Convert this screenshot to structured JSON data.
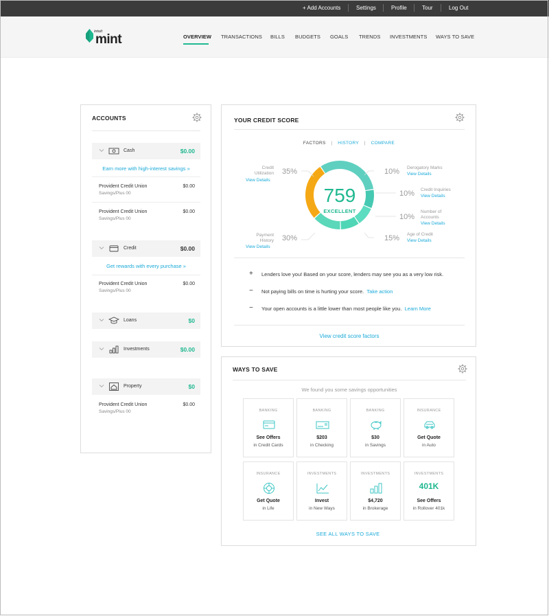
{
  "topbar": {
    "add_accounts": "+ Add Accounts",
    "settings": "Settings",
    "profile": "Profile",
    "tour": "Tour",
    "logout": "Log Out"
  },
  "brand": {
    "small": "intuit",
    "name": "mint",
    "color": "#1fb890"
  },
  "nav": [
    "OVERVIEW",
    "TRANSACTIONS",
    "BILLS",
    "BUDGETS",
    "GOALS",
    "TRENDS",
    "INVESTMENTS",
    "WAYS TO SAVE"
  ],
  "accounts": {
    "title": "ACCOUNTS",
    "cash": {
      "name": "Cash",
      "amount": "$0.00"
    },
    "cash_promo": "Earn more with high-interest savings »",
    "cash_accounts": [
      {
        "name": "Provident Credit Union",
        "sub": "Savings/Plus 00",
        "amount": "$0.00"
      },
      {
        "name": "Provident Credit Union",
        "sub": "Savings/Plus 00",
        "amount": "$0.00"
      }
    ],
    "credit": {
      "name": "Credit",
      "amount": "$0.00"
    },
    "credit_promo": "Get rewards with every purchase »",
    "credit_accounts": [
      {
        "name": "Provident Credit Union",
        "sub": "Savings/Plus 00",
        "amount": "$0.00"
      }
    ],
    "loans": {
      "name": "Loans",
      "amount": "$0"
    },
    "investments": {
      "name": "Investments",
      "amount": "$0.00"
    },
    "property": {
      "name": "Property",
      "amount": "$0"
    },
    "property_accounts": [
      {
        "name": "Provident Credit Union",
        "sub": "Savings/Plus 00",
        "amount": "$0.00"
      }
    ]
  },
  "credit_score": {
    "title": "YOUR CREDIT SCORE",
    "tabs": {
      "factors": "FACTORS",
      "sep": "|",
      "history": "HISTORY",
      "compare": "COMPARE"
    },
    "score": "759",
    "rating": "EXCELLENT",
    "left_factors": [
      {
        "label1": "Credit",
        "label2": "Utilization",
        "link": "View Details",
        "pct": "35%"
      },
      {
        "label1": "Payment",
        "label2": "History",
        "link": "View Details",
        "pct": "30%"
      }
    ],
    "right_factors": [
      {
        "pct": "10%",
        "label1": "Derogatory Marks",
        "label2": "",
        "link": "View Details"
      },
      {
        "pct": "10%",
        "label1": "Credit Inquiries",
        "label2": "",
        "link": "View Details"
      },
      {
        "pct": "10%",
        "label1": "Number of",
        "label2": "Accounts",
        "link": "View Details"
      },
      {
        "pct": "15%",
        "label1": "Age of Credit",
        "label2": "",
        "link": "View Details"
      }
    ],
    "notes": [
      {
        "sym": "+",
        "text": "Lenders love you!  Based on your score, lenders may see you as a very low risk.",
        "link": ""
      },
      {
        "sym": "−",
        "text": "Not paying bills on time is hurting your score.",
        "link": "Take action"
      },
      {
        "sym": "−",
        "text": "Your open accounts is a little lower than most people like you.",
        "link": "Learn More"
      }
    ],
    "footer_link": "View credit score factors",
    "segments": [
      {
        "name": "Credit Utilization",
        "share": 35,
        "color": "#5fd0c0"
      },
      {
        "name": "Derogatory Marks",
        "share": 10,
        "color": "#46c9b2"
      },
      {
        "name": "Credit Inquiries",
        "share": 10,
        "color": "#5cdcc0"
      },
      {
        "name": "Number of Accounts",
        "share": 10,
        "color": "#4fd6b6"
      },
      {
        "name": "Age of Credit",
        "share": 15,
        "color": "#5ad8b9"
      },
      {
        "name": "Payment History",
        "share": 30,
        "color": "#f5a815"
      }
    ]
  },
  "ways_to_save": {
    "title": "WAYS TO SAVE",
    "subtitle": "We found you some savings opportunities",
    "tiles": [
      {
        "category": "BANKING",
        "icon": "credit-card-icon",
        "value": "See Offers",
        "sub": "in Credit Cards"
      },
      {
        "category": "BANKING",
        "icon": "check-icon",
        "value": "$203",
        "sub": "in Checking"
      },
      {
        "category": "BANKING",
        "icon": "piggy-bank-icon",
        "value": "$30",
        "sub": "in Savings"
      },
      {
        "category": "INSURANCE",
        "icon": "car-icon",
        "value": "Get Quote",
        "sub": "in Auto"
      },
      {
        "category": "INSURANCE",
        "icon": "life-ring-icon",
        "value": "Get Quote",
        "sub": "in Life"
      },
      {
        "category": "INVESTMENTS",
        "icon": "line-chart-icon",
        "value": "Invest",
        "sub": "in New Ways"
      },
      {
        "category": "INVESTMENTS",
        "icon": "bar-chart-icon",
        "value": "$4,720",
        "sub": "in Brokerage"
      },
      {
        "category": "INVESTMENTS",
        "icon": "401k-text",
        "big": "401K",
        "value": "See Offers",
        "sub": "in Rollover 401k"
      }
    ],
    "see_all": "SEE ALL WAYS TO SAVE"
  }
}
